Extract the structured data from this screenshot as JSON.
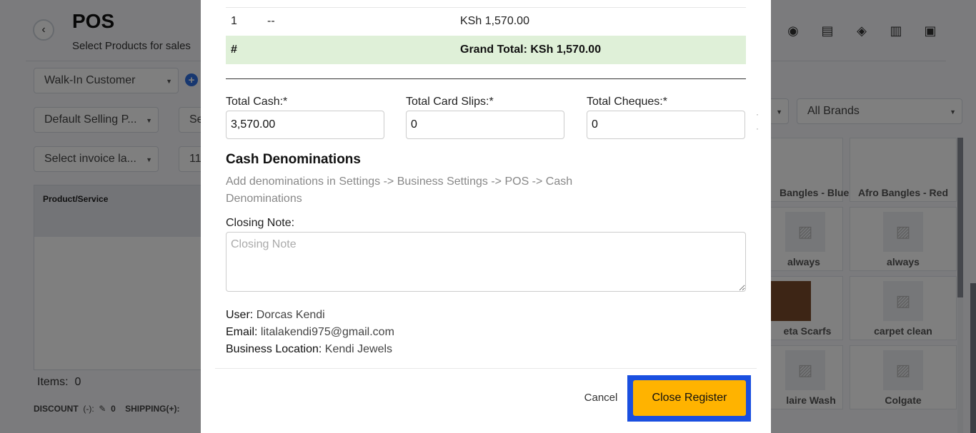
{
  "background": {
    "title": "POS",
    "subtitle": "Select Products for sales",
    "customer_select": "Walk-In Customer",
    "price_group_select": "Default Selling P...",
    "second_select": "Se",
    "invoice_layout_select": "Select invoice la...",
    "date_value": "11/",
    "brands_select": "All Brands",
    "table_header": "Product/Service",
    "items_label": "Items:",
    "items_count": "0",
    "discount_label": "DISCOUNT",
    "discount_sign": "(-):",
    "discount_value": "0",
    "shipping_label": "SHIPPING(+):",
    "products": [
      {
        "name": "Bangles - Blue"
      },
      {
        "name": "Afro Bangles - Red"
      },
      {
        "name": "always"
      },
      {
        "name": "always"
      },
      {
        "name": "eta Scarfs"
      },
      {
        "name": "carpet clean"
      },
      {
        "name": "laire Wash"
      },
      {
        "name": "Colgate"
      }
    ]
  },
  "modal": {
    "summary_row": {
      "index": "1",
      "method": "--",
      "amount": "KSh 1,570.00"
    },
    "total_row": {
      "hash": "#",
      "grand_total": "Grand Total: KSh 1,570.00"
    },
    "total_cash_label": "Total Cash:*",
    "total_cash_value": "3,570.00",
    "total_card_label": "Total Card Slips:*",
    "total_card_value": "0",
    "total_cheques_label": "Total Cheques:*",
    "total_cheques_value": "0",
    "cash_denominations_title": "Cash Denominations",
    "cash_denominations_text": "Add denominations in Settings -> Business Settings -> POS -> Cash Denominations",
    "closing_note_label": "Closing Note:",
    "closing_note_placeholder": "Closing Note",
    "user_label": "User:",
    "user_value": "Dorcas Kendi",
    "email_label": "Email:",
    "email_value": "litalakendi975@gmail.com",
    "location_label": "Business Location:",
    "location_value": "Kendi Jewels",
    "cancel_label": "Cancel",
    "close_register_label": "Close Register"
  },
  "colors": {
    "accent_button": "#ffb300",
    "highlight_border": "#1a4fe0",
    "total_row_bg": "#dff0d8"
  }
}
